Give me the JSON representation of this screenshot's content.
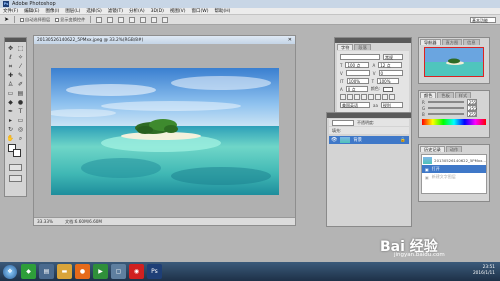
{
  "app": {
    "title": "Adobe Photoshop",
    "logo": "Ps"
  },
  "menu": [
    "文件(F)",
    "编辑(E)",
    "图像(I)",
    "图层(L)",
    "选择(S)",
    "滤镜(T)",
    "分析(A)",
    "3D(D)",
    "视图(V)",
    "窗口(W)",
    "帮助(H)"
  ],
  "options_bar": {
    "auto_select": "自动选择图层",
    "show_transform": "显示变换控件",
    "workspace": "基本功能"
  },
  "document": {
    "title": "20130526140622_5PMxx.jpeg @ 33.2%(RGB/8#)",
    "zoom": "33.33%",
    "doc_info": "文档:6.60M/6.60M"
  },
  "char_panel": {
    "tabs": [
      "字符",
      "段落"
    ],
    "font_style": "常规",
    "size": "100 点",
    "leading": "12 点",
    "tracking": "0",
    "scale_v": "100%",
    "scale_h": "100%",
    "baseline": "0 点",
    "color_label": "颜色:",
    "lang": "美国英语",
    "aa": "锐利"
  },
  "layers_panel": {
    "layer_name": "背景",
    "opacity_label": "不透明度:",
    "fill_label": "填充:"
  },
  "navigator": {
    "tabs": [
      "导航器",
      "直方图",
      "信息"
    ]
  },
  "color_panel": {
    "tabs": [
      "颜色",
      "色板",
      "样式"
    ],
    "r": "255",
    "g": "255",
    "b": "255"
  },
  "history_panel": {
    "tabs": [
      "历史记录",
      "动作"
    ],
    "items": [
      "20130526140622_5PMxx...",
      "打开",
      "新建文字图层"
    ]
  },
  "taskbar": {
    "time": "23:51",
    "date": "2016/1/11"
  },
  "watermark": {
    "brand": "Bai 经验",
    "url": "jingyan.baidu.com"
  },
  "colors": {
    "accent": "#2a5d98",
    "selected": "#3f78c8"
  }
}
